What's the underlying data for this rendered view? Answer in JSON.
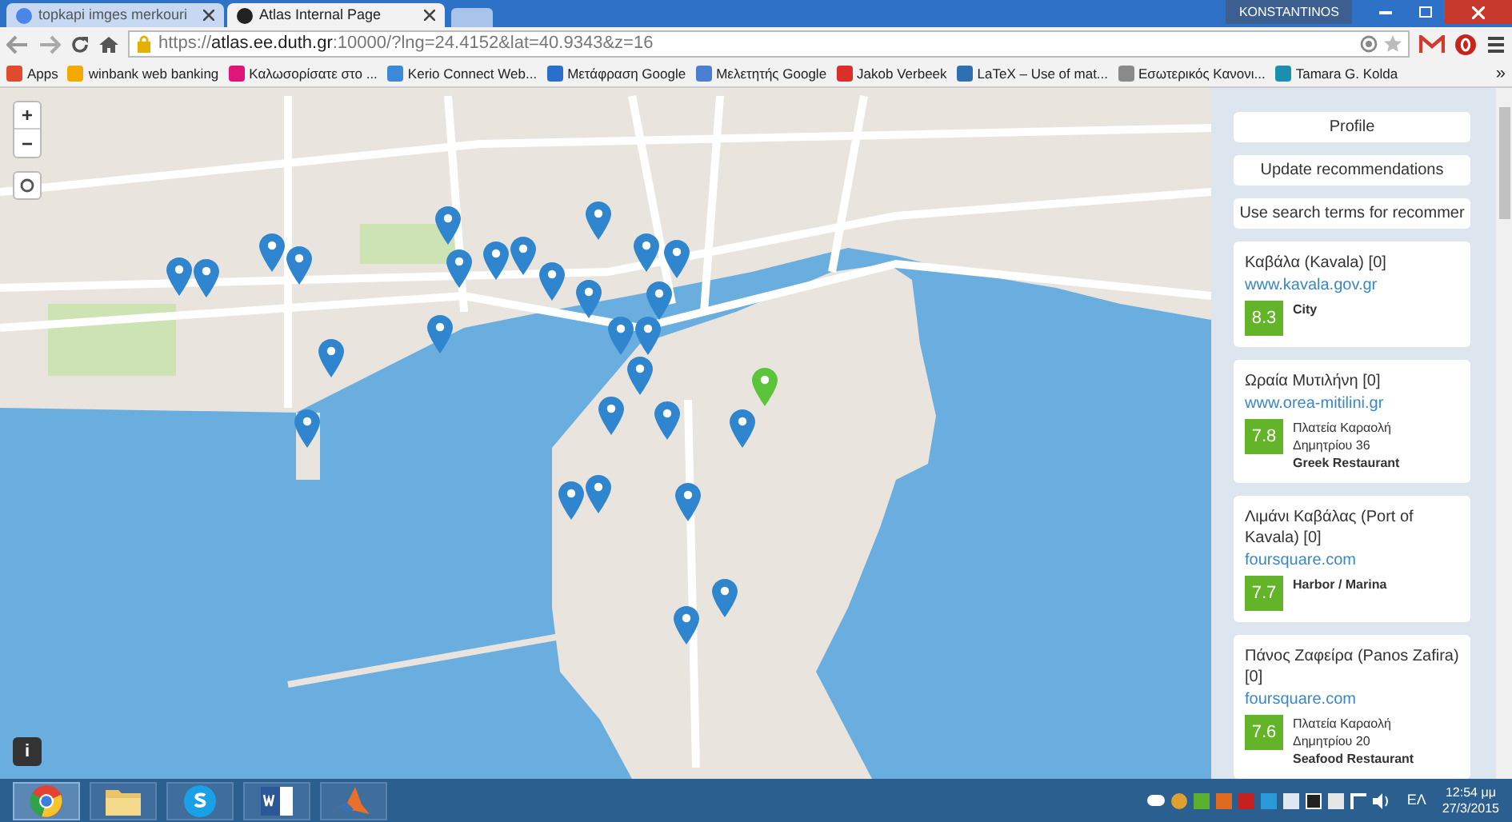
{
  "browser": {
    "tabs": [
      {
        "title": "topkapi imges merkouri",
        "selected": false
      },
      {
        "title": "Atlas Internal Page",
        "selected": true
      }
    ],
    "user": "KONSTANTINOS",
    "url": {
      "scheme": "https://",
      "host": "atlas.ee.duth.gr",
      "rest": ":10000/?lng=24.4152&lat=40.9343&z=16"
    },
    "bookmarks": [
      {
        "label": "Apps",
        "color": "#e04a2f"
      },
      {
        "label": "winbank web banking",
        "color": "#f2a900"
      },
      {
        "label": "Καλωσορίσατε στο ...",
        "color": "#e0157a"
      },
      {
        "label": "Kerio Connect Web...",
        "color": "#3b8ad8"
      },
      {
        "label": "Μετάφραση Google",
        "color": "#2a6fc9"
      },
      {
        "label": "Μελετητής Google",
        "color": "#4a7fd0"
      },
      {
        "label": "Jakob Verbeek",
        "color": "#d9302a"
      },
      {
        "label": "LaTeX – Use of mat...",
        "color": "#2f6fb0"
      },
      {
        "label": "Εσωτερικός Κανονι...",
        "color": "#8a8a8a"
      },
      {
        "label": "Tamara G. Kolda",
        "color": "#1a8fb0"
      }
    ],
    "bookmarks_more": "»"
  },
  "map": {
    "zoom_in": "+",
    "zoom_out": "−",
    "info": "i"
  },
  "sidebar": {
    "buttons": [
      "Profile",
      "Update recommendations",
      "Use search terms for recommer"
    ],
    "places": [
      {
        "name": "Καβάλα (Kavala) [0]",
        "link": "www.kavala.gov.gr",
        "score": "8.3",
        "details": [
          {
            "text": "City",
            "bold": true
          }
        ]
      },
      {
        "name": "Ωραία Μυτιλήνη [0]",
        "link": "www.orea-mitilini.gr",
        "score": "7.8",
        "details": [
          {
            "text": "Πλατεία Καραολή",
            "bold": false
          },
          {
            "text": "Δημητρίου 36",
            "bold": false
          },
          {
            "text": "Greek Restaurant",
            "bold": true
          }
        ]
      },
      {
        "name": "Λιμάνι Καβάλας (Port of Kavala) [0]",
        "link": "foursquare.com",
        "score": "7.7",
        "details": [
          {
            "text": "Harbor / Marina",
            "bold": true
          }
        ]
      },
      {
        "name": "Πάνος Ζαφείρα (Panos Zafira) [0]",
        "link": "foursquare.com",
        "score": "7.6",
        "details": [
          {
            "text": "Πλατεία Καραολή",
            "bold": false
          },
          {
            "text": "Δημητρίου 20",
            "bold": false
          },
          {
            "text": "Seafood Restaurant",
            "bold": true
          }
        ]
      }
    ]
  },
  "taskbar": {
    "apps": [
      {
        "kind": "chrome",
        "selected": true
      },
      {
        "kind": "folder",
        "selected": false
      },
      {
        "kind": "skype",
        "selected": false
      },
      {
        "kind": "word",
        "selected": false
      },
      {
        "kind": "matlab",
        "selected": false
      }
    ],
    "language": "ΕΛ",
    "time": "12:54 μμ",
    "date": "27/3/2015"
  }
}
